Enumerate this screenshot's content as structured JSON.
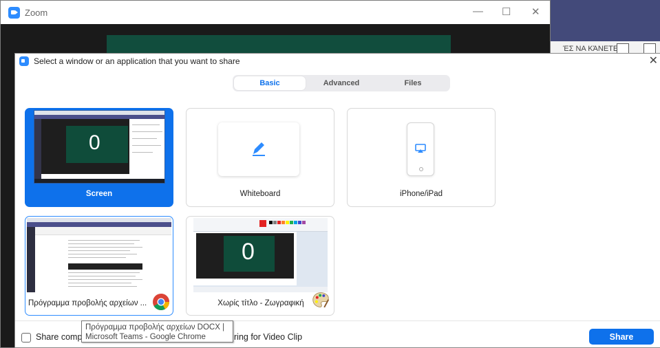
{
  "zoom_window": {
    "title": "Zoom",
    "controls": {
      "minimize": "—",
      "maximize": "☐",
      "close": "✕"
    }
  },
  "background_app": {
    "partial_text": "ΈΣ ΝΑ ΚΆΝΕΤΕ:"
  },
  "dialog": {
    "title": "Select a window or an application that you want to share",
    "close_glyph": "✕",
    "tabs": [
      {
        "label": "Basic",
        "active": true
      },
      {
        "label": "Advanced",
        "active": false
      },
      {
        "label": "Files",
        "active": false
      }
    ],
    "cards": {
      "screen": {
        "label": "Screen",
        "thumb_text": "0"
      },
      "whiteboard": {
        "label": "Whiteboard",
        "icon": "pen-icon"
      },
      "iphone": {
        "label": "iPhone/iPad",
        "icon": "airplay-icon"
      },
      "chrome_window": {
        "label": "Πρόγραμμα προβολής αρχείων ...",
        "icon": "chrome-icon"
      },
      "paint_window": {
        "label": "Χωρίς τίτλο - Ζωγραφική",
        "icon": "paint-palette-icon",
        "thumb_text": "0"
      }
    },
    "bottom": {
      "share_sound_label_left": "Share comp",
      "share_sound_label_right": "ring for Video Clip",
      "share_button": "Share"
    },
    "tooltip": {
      "line1": "Πρόγραμμα προβολής αρχείων DOCX |",
      "line2": "Microsoft Teams - Google Chrome"
    }
  },
  "colors": {
    "accent": "#0e71eb",
    "zoom_blue": "#2d8cff",
    "teams_purple": "#4b4f8b",
    "meeting_green": "#0f4c3a"
  }
}
